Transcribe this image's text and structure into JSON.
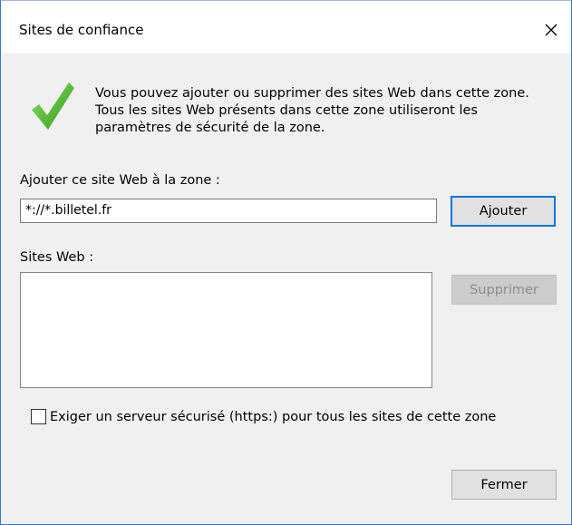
{
  "window": {
    "title": "Sites de confiance",
    "close_icon": "close-icon"
  },
  "intro": {
    "icon": "checkmark-icon",
    "text": "Vous pouvez ajouter ou supprimer des sites Web dans cette zone. Tous les sites Web présents dans cette zone utiliseront les paramètres de sécurité de la zone."
  },
  "add_site": {
    "label": "Ajouter ce site Web à la zone :",
    "value": "*://*.billetel.fr",
    "button_label": "Ajouter"
  },
  "sites": {
    "label": "Sites Web :",
    "items": [],
    "remove_label": "Supprimer",
    "remove_enabled": false
  },
  "https": {
    "label": "Exiger un serveur sécurisé (https:) pour tous les sites de cette zone",
    "checked": false
  },
  "footer": {
    "close_label": "Fermer"
  },
  "colors": {
    "accent": "#0078d7",
    "check_green": "#4caf2a",
    "dialog_bg": "#f0f0f0"
  }
}
